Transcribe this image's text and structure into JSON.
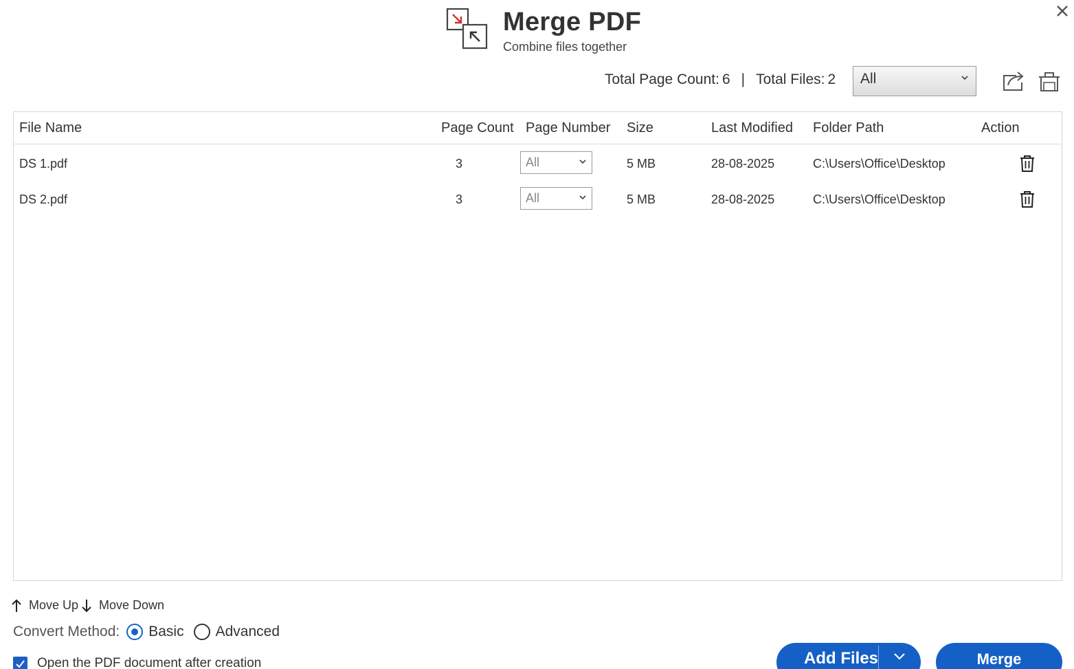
{
  "header": {
    "title": "Merge PDF",
    "subtitle": "Combine files together"
  },
  "totals": {
    "page_count_label": "Total Page Count:",
    "page_count_value": "6",
    "separator": "|",
    "files_label": "Total Files:",
    "files_value": "2"
  },
  "filter": {
    "selected": "All"
  },
  "table": {
    "headers": [
      "File Name",
      "Page Count",
      "Page Number",
      "Size",
      "Last Modified",
      "Folder Path",
      "Action"
    ],
    "rows": [
      {
        "file_name": "DS 1.pdf",
        "page_count": "3",
        "page_number": "All",
        "size": "5 MB",
        "last_modified": "28-08-2025",
        "folder_path": "C:\\Users\\Office\\Desktop"
      },
      {
        "file_name": "DS 2.pdf",
        "page_count": "3",
        "page_number": "All",
        "size": "5 MB",
        "last_modified": "28-08-2025",
        "folder_path": "C:\\Users\\Office\\Desktop"
      }
    ]
  },
  "controls": {
    "move_up": "Move Up",
    "move_down": "Move Down",
    "convert_method_label": "Convert Method:",
    "option_basic": "Basic",
    "option_advanced": "Advanced",
    "selected_method": "Basic",
    "open_after_label": "Open the PDF document after creation",
    "open_after_checked": true
  },
  "buttons": {
    "add_files": "Add Files",
    "merge": "Merge"
  },
  "colors": {
    "accent": "#1560c6",
    "logo_arrow": "#d32f2f"
  },
  "icons": {
    "logo": "merge-arrows-icon",
    "close": "close-icon",
    "share": "share-icon",
    "clear_all": "clear-all-icon",
    "row_delete": "trash-icon",
    "move_up": "arrow-up-icon",
    "move_down": "arrow-down-icon",
    "dropdown": "chevron-down-icon"
  }
}
